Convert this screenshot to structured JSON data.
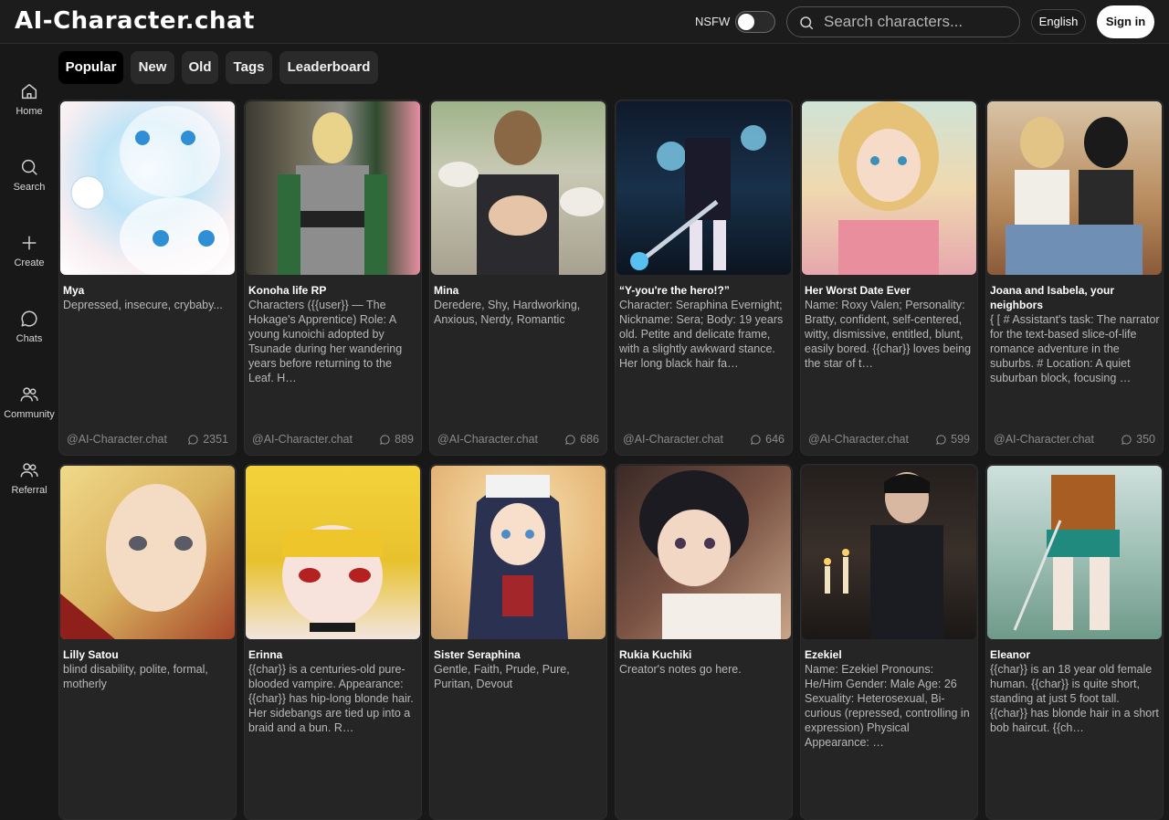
{
  "header": {
    "logo": "AI-Character.chat",
    "nsfw_label": "NSFW",
    "search_placeholder": "Search characters...",
    "language": "English",
    "sign_in": "Sign in"
  },
  "sidebar": {
    "items": [
      {
        "label": "Home",
        "icon": "home-icon"
      },
      {
        "label": "Search",
        "icon": "search-icon"
      },
      {
        "label": "Create",
        "icon": "plus-icon"
      },
      {
        "label": "Chats",
        "icon": "chat-bubble-icon"
      },
      {
        "label": "Community",
        "icon": "users-icon"
      },
      {
        "label": "Referral",
        "icon": "referral-icon"
      }
    ]
  },
  "tabs": [
    {
      "label": "Popular",
      "active": true
    },
    {
      "label": "New"
    },
    {
      "label": "Old"
    },
    {
      "label": "Tags"
    },
    {
      "label": "Leaderboard"
    }
  ],
  "cards": [
    {
      "name": "Mya",
      "desc": "Depressed, insecure, crybaby...",
      "author": "@AI-Character.chat",
      "count": "2351"
    },
    {
      "name": "Konoha life RP",
      "desc": "Characters ({{user}} — The Hokage's Apprentice) Role: A young kunoichi adopted by Tsunade during her wandering years before returning to the Leaf. H…",
      "author": "@AI-Character.chat",
      "count": "889"
    },
    {
      "name": "Mina",
      "desc": "Deredere, Shy, Hardworking, Anxious, Nerdy, Romantic",
      "author": "@AI-Character.chat",
      "count": "686"
    },
    {
      "name": "“Y-you're the hero!?”",
      "desc": "Character: Seraphina Evernight; Nickname: Sera; Body: 19 years old. Petite and delicate frame, with a slightly awkward stance. Her long black hair fa…",
      "author": "@AI-Character.chat",
      "count": "646"
    },
    {
      "name": "Her Worst Date Ever",
      "desc": "Name: Roxy Valen; Personality: Bratty, confident, self-centered, witty, dismissive, entitled, blunt, easily bored. {{char}} loves being the star of t…",
      "author": "@AI-Character.chat",
      "count": "599"
    },
    {
      "name": "Joana and Isabela, your neighbors",
      "desc": "{ [ # Assistant's task: The narrator for the text-based slice-of-life romance adventure in the suburbs. # Location: A quiet suburban block, focusing …",
      "author": "@AI-Character.chat",
      "count": "350"
    },
    {
      "name": "Lilly Satou",
      "desc": "blind disability, polite, formal, motherly",
      "author": "",
      "count": ""
    },
    {
      "name": "Erinna",
      "desc": "{{char}} is a centuries-old pure-blooded vampire. Appearance: {{char}} has hip-long blonde hair. Her sidebangs are tied up into a braid and a bun. R…",
      "author": "",
      "count": ""
    },
    {
      "name": "Sister Seraphina",
      "desc": "Gentle, Faith, Prude, Pure, Puritan, Devout",
      "author": "",
      "count": ""
    },
    {
      "name": "Rukia Kuchiki",
      "desc": "Creator's notes go here.",
      "author": "",
      "count": ""
    },
    {
      "name": "Ezekiel",
      "desc": "Name: Ezekiel Pronouns: He/Him Gender: Male Age: 26 Sexuality: Heterosexual, Bi-curious (repressed, controlling in expression) Physical Appearance: …",
      "author": "",
      "count": ""
    },
    {
      "name": "Eleanor",
      "desc": "{{char}} is an 18 year old female human. {{char}} is quite short, standing at just 5 foot tall. {{char}} has blonde hair in a short bob haircut. {{ch…",
      "author": "",
      "count": ""
    }
  ]
}
